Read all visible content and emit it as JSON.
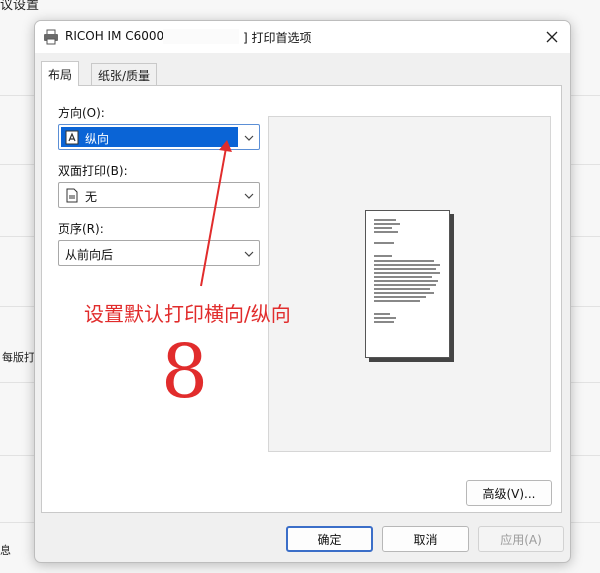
{
  "background": {
    "title_fragment": "议设置",
    "side_label_a": "每版打",
    "side_label_b": "息"
  },
  "dialog": {
    "title_printer": "RICOH IM C6000 [",
    "title_suffix": "] 打印首选项",
    "close_icon": "close-icon",
    "tabs": [
      {
        "label": "布局",
        "active": true
      },
      {
        "label": "纸张/质量",
        "active": false
      }
    ],
    "layout": {
      "orientation": {
        "label": "方向(O):",
        "value": "纵向",
        "icon": "portrait-page-icon"
      },
      "duplex": {
        "label": "双面打印(B):",
        "value": "无",
        "icon": "page-icon"
      },
      "page_order": {
        "label": "页序(R):",
        "value": "从前向后"
      }
    },
    "buttons": {
      "advanced": "高级(V)...",
      "ok": "确定",
      "cancel": "取消",
      "apply": "应用(A)"
    }
  },
  "annotation": {
    "text": "设置默认打印横向/纵向",
    "number": "8",
    "color": "#e12c2c"
  },
  "colors": {
    "selection": "#0a64d6",
    "default_button_border": "#3b6ec8"
  }
}
